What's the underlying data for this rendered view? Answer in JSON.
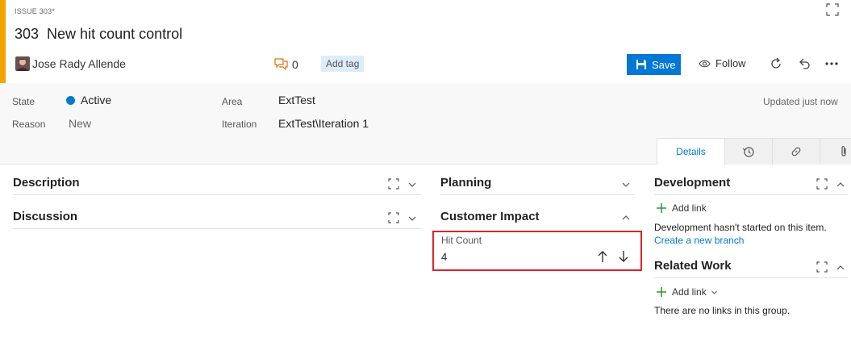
{
  "header": {
    "type_label": "ISSUE 303*",
    "id": "303",
    "title": "New hit count control",
    "assignee": "Jose Rady Allende",
    "comment_count": "0",
    "add_tag_label": "Add tag",
    "save_label": "Save",
    "follow_label": "Follow"
  },
  "fields": {
    "state_label": "State",
    "state_value": "Active",
    "reason_label": "Reason",
    "reason_value": "New",
    "area_label": "Area",
    "area_value": "ExtTest",
    "iteration_label": "Iteration",
    "iteration_value": "ExtTest\\Iteration 1",
    "updated_text": "Updated just now"
  },
  "tabs": {
    "details_label": "Details"
  },
  "sections": {
    "description": "Description",
    "discussion": "Discussion",
    "planning": "Planning",
    "customer_impact": "Customer Impact",
    "hit_count_label": "Hit Count",
    "hit_count_value": "4",
    "development": "Development",
    "dev_add_link": "Add link",
    "dev_empty_text": "Development hasn't started on this item.",
    "create_branch": "Create a new branch",
    "related_work": "Related Work",
    "related_add_link": "Add link",
    "related_empty_text": "There are no links in this group."
  },
  "colors": {
    "accent": "#f2a300",
    "primary": "#0078d4",
    "state_active": "#007acc",
    "highlight_box": "#e0232c",
    "add_green": "#339933"
  },
  "icons": [
    "fullscreen-icon",
    "comment-icon",
    "save-icon",
    "eye-icon",
    "refresh-icon",
    "undo-icon",
    "more-icon",
    "history-icon",
    "link-icon",
    "attachment-icon",
    "chevron-down-icon",
    "chevron-up-icon",
    "arrow-up-icon",
    "arrow-down-icon",
    "plus-icon"
  ]
}
